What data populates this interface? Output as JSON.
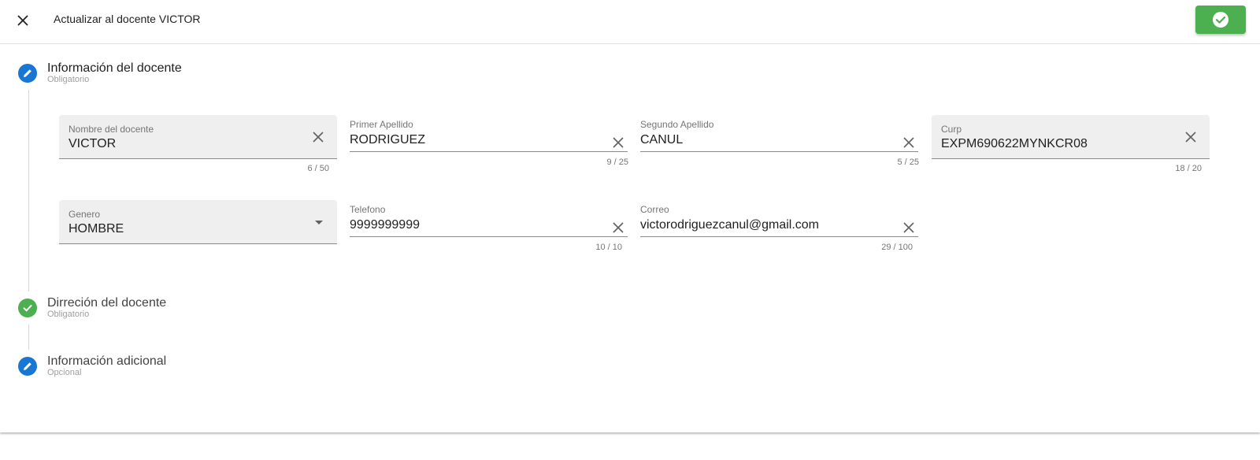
{
  "dialog": {
    "title": "Actualizar al docente VICTOR",
    "close_icon": "close-icon",
    "confirm_icon": "check-circle-icon",
    "confirm_color": "#4caf50"
  },
  "steps": [
    {
      "title": "Información del docente",
      "subtitle": "Obligatorio",
      "icon": "edit-icon",
      "color": "#1976d2",
      "state": "active"
    },
    {
      "title": "Dirreción del docente",
      "subtitle": "Obligatorio",
      "icon": "check-icon",
      "color": "#4caf50",
      "state": "completed"
    },
    {
      "title": "Información adicional",
      "subtitle": "Opcional",
      "icon": "edit-icon",
      "color": "#1976d2",
      "state": "editable"
    }
  ],
  "form": {
    "nombre": {
      "label": "Nombre del docente",
      "value": "VICTOR",
      "counter": "6 / 50"
    },
    "primer_apellido": {
      "label": "Primer Apellido",
      "value": "RODRIGUEZ",
      "counter": "9 / 25"
    },
    "segundo_apellido": {
      "label": "Segundo Apellido",
      "value": "CANUL",
      "counter": "5 / 25"
    },
    "curp": {
      "label": "Curp",
      "value": "EXPM690622MYNKCR08",
      "counter": "18 / 20"
    },
    "genero": {
      "label": "Genero",
      "value": "HOMBRE"
    },
    "telefono": {
      "label": "Telefono",
      "value": "9999999999",
      "counter": "10 / 10"
    },
    "correo": {
      "label": "Correo",
      "value": "victorodriguezcanul@gmail.com",
      "counter": "29 / 100"
    }
  }
}
